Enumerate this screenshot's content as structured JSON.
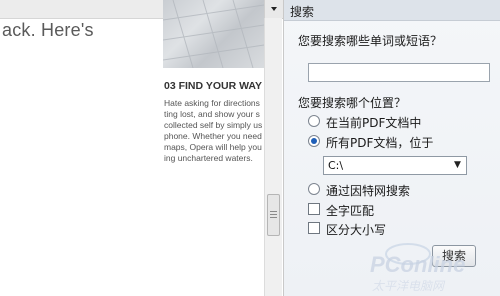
{
  "document": {
    "top_text_fragment": "ack. Here's",
    "heading": "03 FIND YOUR WAY",
    "body_lines": [
      "Hate asking for directions",
      "ting lost, and show your s",
      "collected self by simply us",
      "phone. Whether you need",
      "maps, Opera will help you",
      "ing unchartered waters."
    ]
  },
  "search_pane": {
    "title": "搜索",
    "question_term": "您要搜索哪些单词或短语？",
    "term_value": "",
    "question_location": "您要搜索哪个位置？",
    "option_current_pdf": "在当前PDF文档中",
    "option_all_pdfs": "所有PDF文档，位于",
    "location_value": "C:\\",
    "option_internet": "通过因特网搜索",
    "check_whole_word": "全字匹配",
    "check_case_sensitive": "区分大小写",
    "search_button": "搜索"
  },
  "watermark": {
    "brand": "PConline",
    "subtitle": "太平洋电脑网"
  },
  "colors": {
    "radio_selected": "#1f5fb8",
    "pane_header": "#dde3ea"
  }
}
